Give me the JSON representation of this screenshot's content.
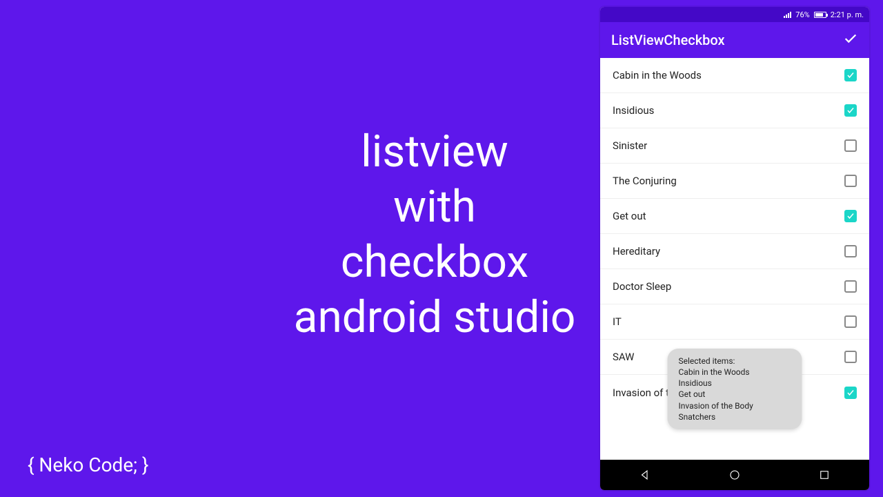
{
  "slide": {
    "title": "listview\nwith\ncheckbox\nandroid studio",
    "brand": "{ Neko Code; }"
  },
  "status": {
    "battery_pct": "76%",
    "time": "2:21 p. m."
  },
  "appbar": {
    "title": "ListViewCheckbox"
  },
  "items": [
    {
      "label": "Cabin in the Woods",
      "checked": true
    },
    {
      "label": "Insidious",
      "checked": true
    },
    {
      "label": "Sinister",
      "checked": false
    },
    {
      "label": "The Conjuring",
      "checked": false
    },
    {
      "label": "Get out",
      "checked": true
    },
    {
      "label": "Hereditary",
      "checked": false
    },
    {
      "label": "Doctor Sleep",
      "checked": false
    },
    {
      "label": "IT",
      "checked": false
    },
    {
      "label": "SAW",
      "checked": false
    },
    {
      "label": "Invasion of the Body Snatchers",
      "checked": true
    }
  ],
  "toast": {
    "header": "Selected items:",
    "lines": [
      "Cabin in the Woods",
      "Insidious",
      "Get out",
      "Invasion of the Body Snatchers"
    ]
  }
}
